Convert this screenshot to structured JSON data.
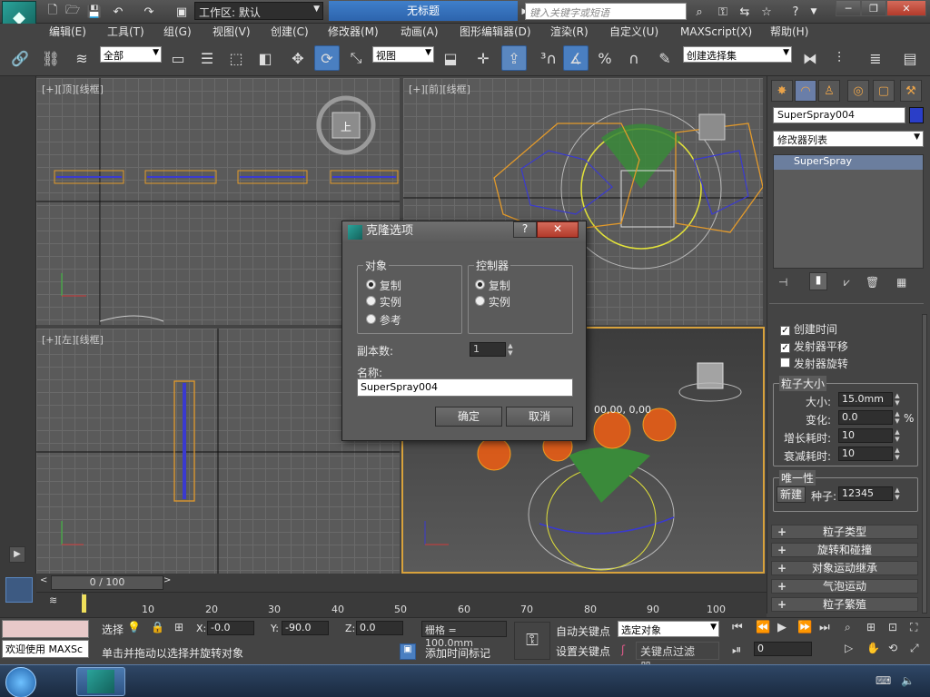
{
  "title": {
    "workspace_label": "工作区: 默认",
    "doc": "无标题",
    "search_placeholder": "键入关键字或短语"
  },
  "menu": [
    "编辑(E)",
    "工具(T)",
    "组(G)",
    "视图(V)",
    "创建(C)",
    "修改器(M)",
    "动画(A)",
    "图形编辑器(D)",
    "渲染(R)",
    "自定义(U)",
    "MAXScript(X)",
    "帮助(H)"
  ],
  "toolbar": {
    "selection_filter": "全部",
    "ref_coord": "视图",
    "named_selection": "创建选择集"
  },
  "viewports": {
    "top": "[+][顶][线框]",
    "front": "[+][前][线框]",
    "left": "[+][左][线框]",
    "viewcube_top": "上",
    "overlay_numbers": "00,00, 0,00"
  },
  "dialog": {
    "title": "克隆选项",
    "object_group": "对象",
    "object_options": [
      "复制",
      "实例",
      "参考"
    ],
    "controller_group": "控制器",
    "controller_options": [
      "复制",
      "实例"
    ],
    "copies_label": "副本数:",
    "copies_value": "1",
    "name_label": "名称:",
    "name_value": "SuperSpray004",
    "ok": "确定",
    "cancel": "取消"
  },
  "cmdpanel": {
    "object_name": "SuperSpray004",
    "object_color": "#2a3ec8",
    "modifier_list": "修改器列表",
    "stack_item": "SuperSpray",
    "checks": [
      {
        "label": "创建时间",
        "on": true
      },
      {
        "label": "发射器平移",
        "on": true
      },
      {
        "label": "发射器旋转",
        "on": false
      }
    ],
    "particle_size_title": "粒子大小",
    "size_label": "大小:",
    "size_value": "15.0mm",
    "variation_label": "变化:",
    "variation_value": "0.0",
    "variation_unit": "%",
    "grow_label": "增长耗时:",
    "grow_value": "10",
    "fade_label": "衰减耗时:",
    "fade_value": "10",
    "uniqueness_title": "唯一性",
    "new_label": "新建",
    "seed_label": "种子:",
    "seed_value": "12345",
    "rollouts": [
      "粒子类型",
      "旋转和碰撞",
      "对象运动继承",
      "气泡运动",
      "粒子繁殖"
    ]
  },
  "timeline": {
    "frame": "0 / 100",
    "ticks": [
      "10",
      "20",
      "30",
      "40",
      "50",
      "60",
      "70",
      "80",
      "90",
      "100"
    ]
  },
  "status": {
    "welcome": "欢迎使用 MAXSc",
    "select_label": "选择",
    "hint": "单击并拖动以选择并旋转对象",
    "x_label": "X:",
    "x_value": "-0.0",
    "y_label": "Y:",
    "y_value": "-90.0",
    "z_label": "Z:",
    "z_value": "0.0",
    "grid": "栅格 = 100.0mm",
    "add_time_tag": "添加时间标记",
    "auto_key": "自动关键点",
    "set_key": "设置关键点",
    "selected_obj": "选定对象",
    "key_filters": "关键点过滤器...",
    "frame_field": "0"
  }
}
